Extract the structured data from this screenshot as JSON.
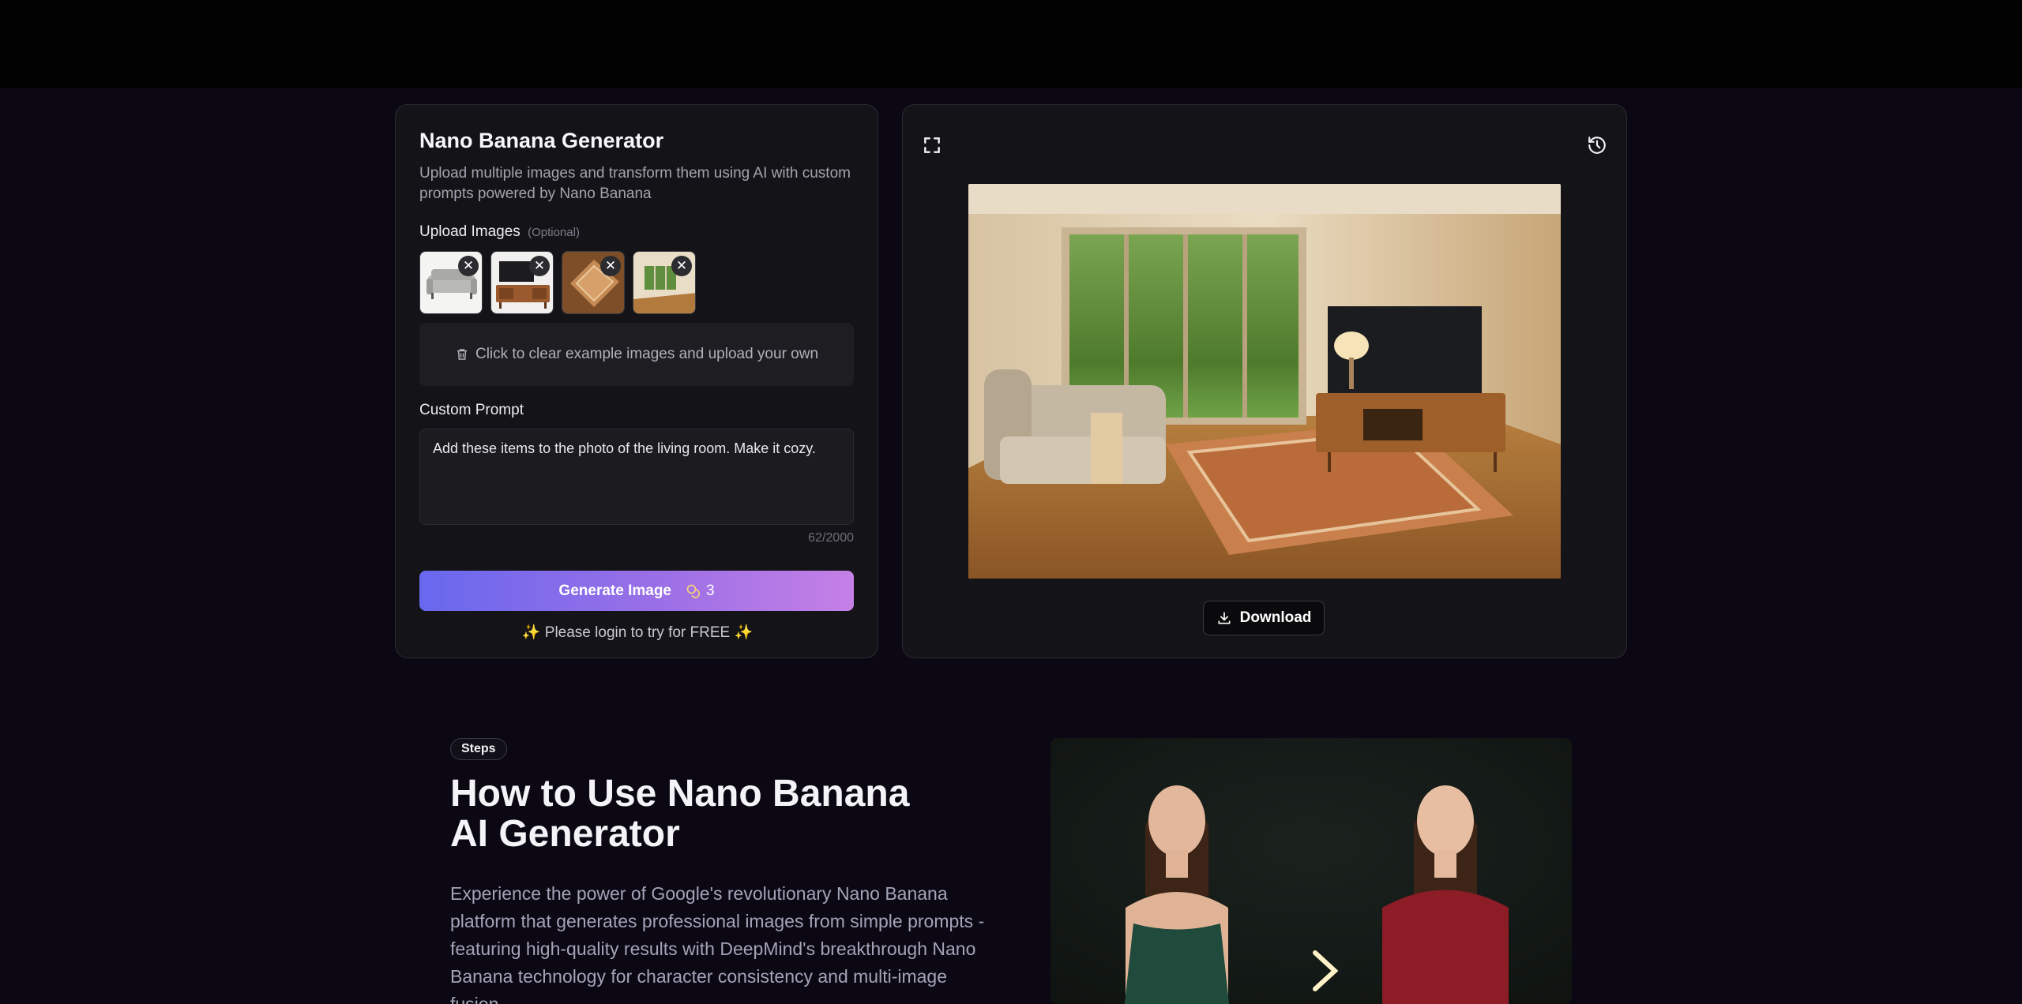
{
  "generator": {
    "title": "Nano Banana Generator",
    "description": "Upload multiple images and transform them using AI with custom prompts powered by Nano Banana",
    "upload_label": "Upload Images",
    "upload_optional": "(Optional)",
    "thumbnails": [
      "sofa",
      "tv-stand",
      "rug",
      "living-room"
    ],
    "remove_symbol": "✕",
    "clear_text": "Click to clear example images and upload your own",
    "prompt_label": "Custom Prompt",
    "prompt_value": "Add these items to the photo of the living room. Make it cozy.",
    "char_count": "62/2000",
    "generate_label": "Generate Image",
    "credits": "3",
    "login_hint": "Please login to try for FREE",
    "spark": "✨"
  },
  "preview": {
    "download_label": "Download"
  },
  "steps": {
    "badge": "Steps",
    "title": "How to Use Nano Banana AI Generator",
    "description": "Experience the power of Google's revolutionary Nano Banana platform that generates professional images from simple prompts - featuring high-quality results with DeepMind's breakthrough Nano Banana technology for character consistency and multi-image fusion."
  },
  "colors": {
    "background": "#0b0814",
    "panel": "#141418",
    "accent_start": "#6868ee",
    "accent_end": "#c580e6"
  }
}
